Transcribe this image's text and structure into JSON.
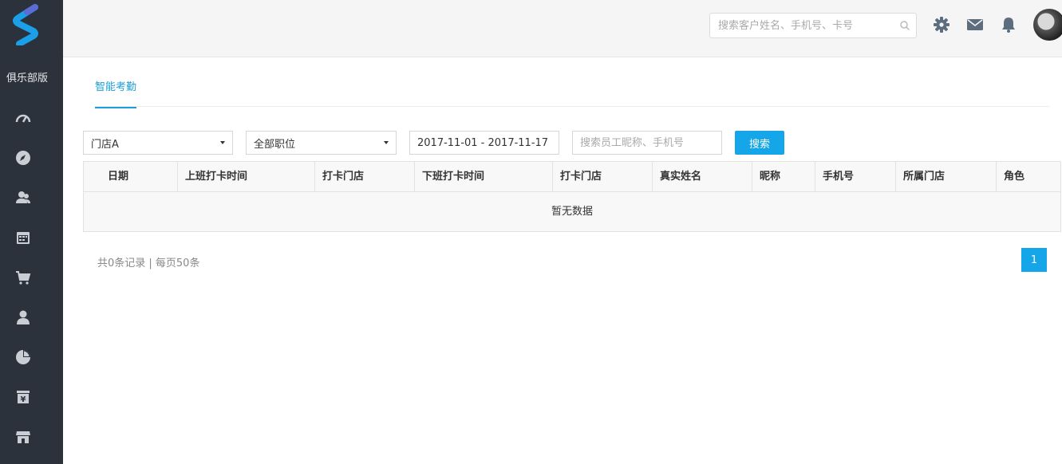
{
  "sidebar": {
    "club_label": "俱乐部版",
    "icons": [
      "dashboard-icon",
      "compass-icon",
      "members-icon",
      "calendar-icon",
      "cart-icon",
      "user-icon",
      "pie-chart-icon",
      "finance-icon",
      "store-icon"
    ]
  },
  "header": {
    "search_placeholder": "搜索客户姓名、手机号、卡号"
  },
  "tabs": [
    {
      "label": "智能考勤"
    }
  ],
  "filters": {
    "store": "门店A",
    "position": "全部职位",
    "date_range": "2017-11-01 - 2017-11-17",
    "keyword_placeholder": "搜索员工昵称、手机号",
    "search_button": "搜索"
  },
  "table": {
    "columns": [
      "日期",
      "上班打卡时间",
      "打卡门店",
      "下班打卡时间",
      "打卡门店",
      "真实姓名",
      "昵称",
      "手机号",
      "所属门店",
      "角色"
    ],
    "empty_text": "暂无数据"
  },
  "pagination": {
    "records_text": "共0条记录 | 每页50条",
    "current_page": "1"
  },
  "colors": {
    "accent": "#14a6e8",
    "sidebar_bg": "#2b323b",
    "logo_blue": "#1a9fe8"
  }
}
